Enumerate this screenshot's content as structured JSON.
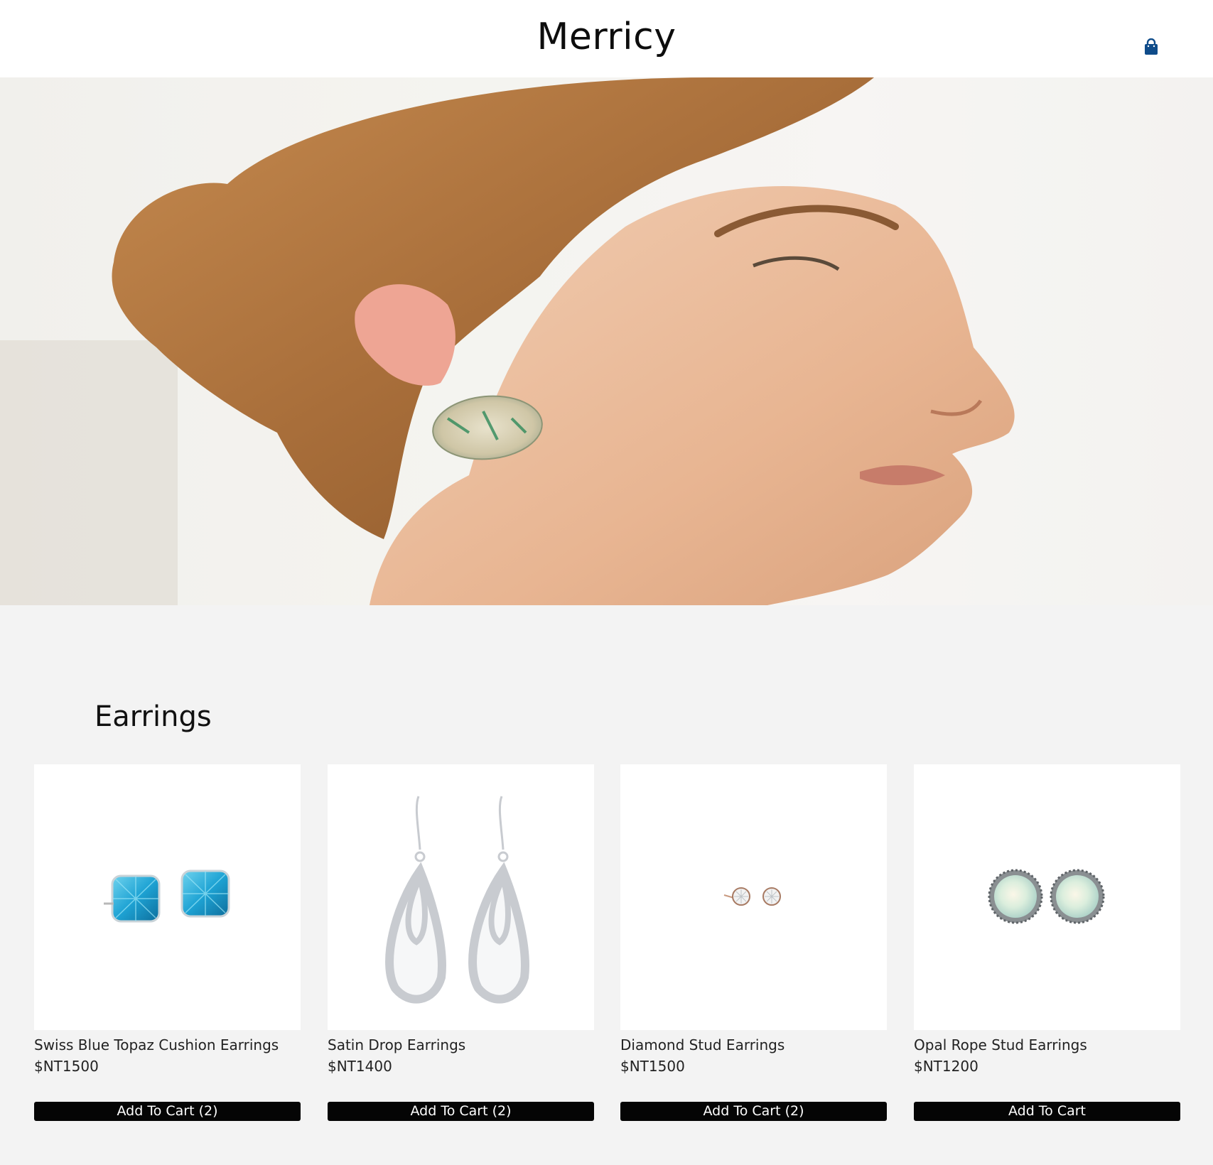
{
  "header": {
    "brand": "Merricy",
    "cart_icon": "shopping-bag-icon",
    "cart_icon_color": "#0f4c8a"
  },
  "hero": {
    "image": "woman-wearing-oval-earring-photo"
  },
  "section": {
    "title": "Earrings"
  },
  "products": [
    {
      "name": "Swiss Blue Topaz Cushion Earrings",
      "price": "$NT1500",
      "button": "Add To Cart (2)",
      "image": "blue-topaz-earrings-photo"
    },
    {
      "name": "Satin Drop Earrings",
      "price": "$NT1400",
      "button": "Add To Cart (2)",
      "image": "satin-drop-earrings-photo"
    },
    {
      "name": "Diamond Stud Earrings",
      "price": "$NT1500",
      "button": "Add To Cart (2)",
      "image": "diamond-stud-earrings-photo"
    },
    {
      "name": "Opal Rope Stud Earrings",
      "price": "$NT1200",
      "button": "Add To Cart",
      "image": "opal-rope-stud-earrings-photo"
    }
  ],
  "colors": {
    "page_bg": "#f3f3f3",
    "button_bg": "#050505",
    "button_text": "#ffffff",
    "accent": "#0f4c8a"
  }
}
